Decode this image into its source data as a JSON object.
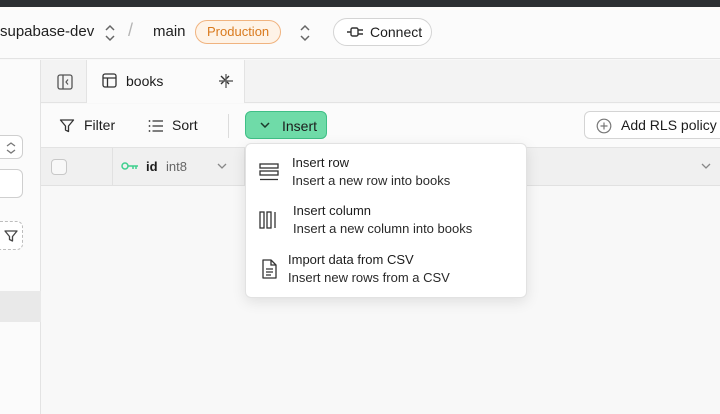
{
  "header": {
    "project": "supabase-dev",
    "branch": "main",
    "env_badge": "Production",
    "connect_label": "Connect"
  },
  "tabs": [
    {
      "label": "books"
    }
  ],
  "toolbar": {
    "filter_label": "Filter",
    "sort_label": "Sort",
    "insert_label": "Insert",
    "rls_label": "Add RLS policy"
  },
  "columns": [
    {
      "name": "id",
      "type": "int8",
      "primary_key": true
    }
  ],
  "insert_menu": [
    {
      "title": "Insert row",
      "description": "Insert a new row into books",
      "icon": "rows-icon"
    },
    {
      "title": "Insert column",
      "description": "Insert a new column into books",
      "icon": "columns-icon"
    },
    {
      "title": "Import data from CSV",
      "description": "Insert new rows from a CSV",
      "icon": "file-icon"
    }
  ],
  "colors": {
    "insert_button": "#6fdba8",
    "badge_text": "#d97a1e",
    "primary_key_icon": "#3ecf8e"
  }
}
